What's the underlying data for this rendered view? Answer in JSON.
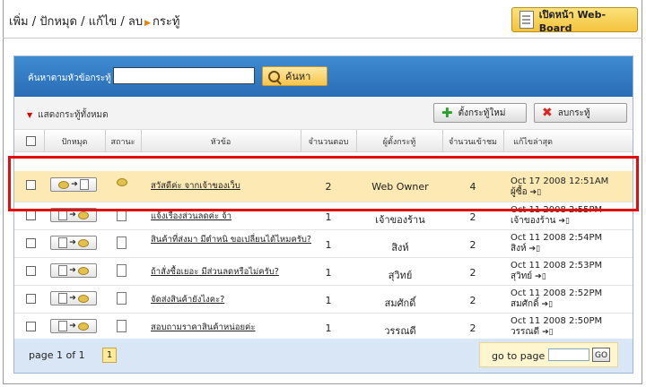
{
  "breadcrumb": "เพิ่ม / ปักหมุด / แก้ไข / ลบ",
  "breadcrumb_current": "กระทู้",
  "webboard_button": "เปิดหน้า Web-Board",
  "search": {
    "label": "ค้นหาตามหัวข้อกระทู้",
    "value": "",
    "button": "ค้นหา"
  },
  "toolbar": {
    "show_all": "แสดงกระทู้ทั้งหมด",
    "new_topic": "ตั้งกระทู้ใหม่",
    "delete_topic": "ลบกระทู้"
  },
  "columns": {
    "pin": "ปักหมุด",
    "status": "สถานะ",
    "subject": "หัวข้อ",
    "replies": "จำนวนตอบ",
    "author": "ผู้ตั้งกระทู้",
    "views": "จำนวนเข้าชม",
    "last": "แก้ไขล่าสุด"
  },
  "rows": [
    {
      "subject": "สวัสดีค่ะ จากเจ้าของเว็บ",
      "replies": "2",
      "author": "Web Owner",
      "views": "4",
      "last_date": "Oct 17 2008 12:51AM",
      "last_user": "ผู้ซื้อ"
    },
    {
      "subject": "แจ้งเรื่องส่วนลดค่ะ จ้า",
      "replies": "1",
      "author": "เจ้าของร้าน",
      "views": "2",
      "last_date": "Oct 11 2008 2:55PM",
      "last_user": "เจ้าของร้าน"
    },
    {
      "subject": "สินค้าที่ส่งมา มีตำหนิ ขอเปลี่ยนได้ไหมครับ?",
      "replies": "1",
      "author": "สิงห์",
      "views": "2",
      "last_date": "Oct 11 2008 2:54PM",
      "last_user": "สิงห์"
    },
    {
      "subject": "ถ้าสั่งซื้อเยอะ มีส่วนลดหรือไม่ครับ?",
      "replies": "1",
      "author": "สุวิทย์",
      "views": "2",
      "last_date": "Oct 11 2008 2:53PM",
      "last_user": "สุวิทย์"
    },
    {
      "subject": "จัดส่งสินค้ายังไงคะ?",
      "replies": "1",
      "author": "สมศักดิ์",
      "views": "2",
      "last_date": "Oct 11 2008 2:52PM",
      "last_user": "สมศักดิ์"
    },
    {
      "subject": "สอบถามราคาสินค้าหน่อยค่ะ",
      "replies": "1",
      "author": "วรรณดี",
      "views": "2",
      "last_date": "Oct 11 2008 2:50PM",
      "last_user": "วรรณดี"
    }
  ],
  "pagination": {
    "info": "page 1 of 1",
    "current": "1",
    "goto_label": "go to page",
    "goto_button": "GO"
  },
  "colors": {
    "header_blue": "#2f79c4",
    "highlight_row": "#fde9b3",
    "annotation_red": "#e30b0b"
  }
}
